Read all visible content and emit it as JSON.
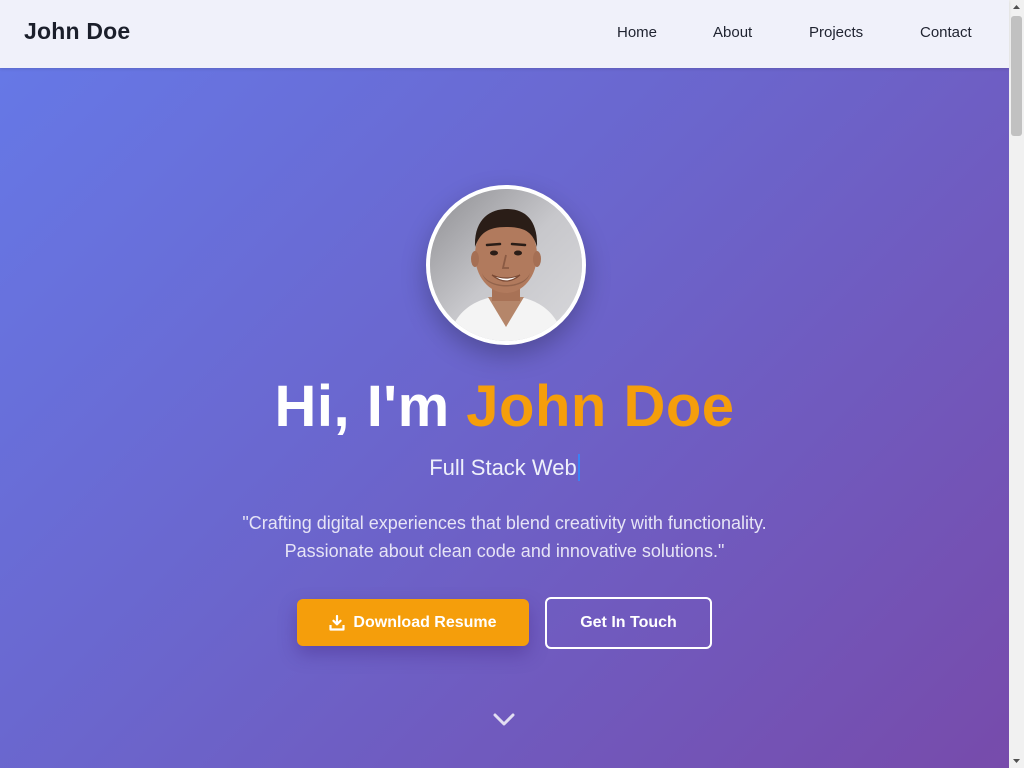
{
  "navbar": {
    "brand": "John Doe",
    "links": [
      "Home",
      "About",
      "Projects",
      "Contact"
    ]
  },
  "hero": {
    "title_prefix": "Hi, I'm ",
    "title_name": "John Doe",
    "subtitle": "Full Stack Web",
    "quote_line1": "\"Crafting digital experiences that blend creativity with functionality.",
    "quote_line2": "Passionate about clean code and innovative solutions.\"",
    "primary_button": "Download Resume",
    "secondary_button": "Get In Touch"
  },
  "icons": {
    "download": "download-icon",
    "scroll": "chevron-down-icon"
  },
  "colors": {
    "accent": "#f59e0b",
    "gradient_start": "#6678e6",
    "gradient_end": "#774bab",
    "navbar_bg": "#f0f1fa",
    "cursor": "#3b82f6"
  }
}
